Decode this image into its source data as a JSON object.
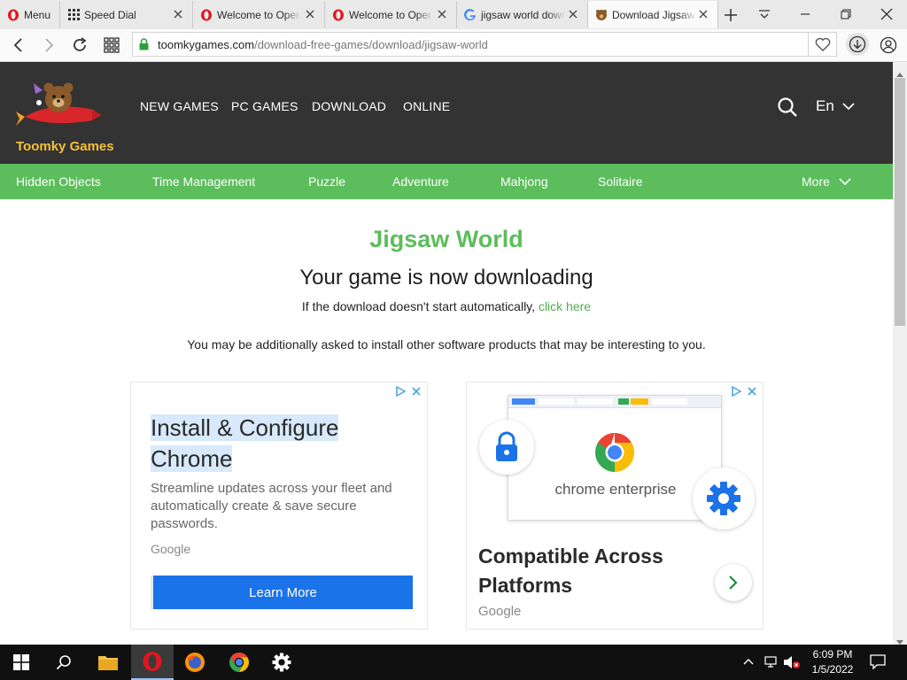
{
  "browser": {
    "menu_label": "Menu",
    "tabs": [
      {
        "title": "Speed Dial"
      },
      {
        "title": "Welcome to Opera"
      },
      {
        "title": "Welcome to Opera"
      },
      {
        "title": "jigsaw world download"
      },
      {
        "title": "Download Jigsaw World"
      }
    ],
    "url_domain": "toomkygames.com",
    "url_path": "/download-free-games/download/jigsaw-world"
  },
  "site": {
    "logo_text": "Toomky Games",
    "top_nav": [
      "NEW GAMES",
      "PC GAMES",
      "DOWNLOAD",
      "ONLINE"
    ],
    "language": "En",
    "categories": [
      "Hidden Objects",
      "Time Management",
      "Puzzle",
      "Adventure",
      "Mahjong",
      "Solitaire"
    ],
    "more_label": "More"
  },
  "content": {
    "game_title": "Jigsaw World",
    "downloading_heading": "Your game is now downloading",
    "fallback_text": "If the download doesn't start automatically, ",
    "click_here": "click here",
    "notice": "You may be additionally asked to install other software products that may be interesting to you."
  },
  "ads": {
    "left": {
      "title_line1": "Install & Configure",
      "title_line2": "Chrome",
      "body": "Streamline updates across your fleet and automatically create & save secure passwords.",
      "advertiser": "Google",
      "cta": "Learn More"
    },
    "right": {
      "image_caption": "chrome enterprise",
      "title": "Compatible Across Platforms",
      "advertiser": "Google"
    }
  },
  "taskbar": {
    "time": "6:09 PM",
    "date": "1/5/2022"
  },
  "colors": {
    "green": "#5cbd5c",
    "header_dark": "#333333",
    "link_green": "#4caf50",
    "cta_blue": "#1a73e8"
  }
}
